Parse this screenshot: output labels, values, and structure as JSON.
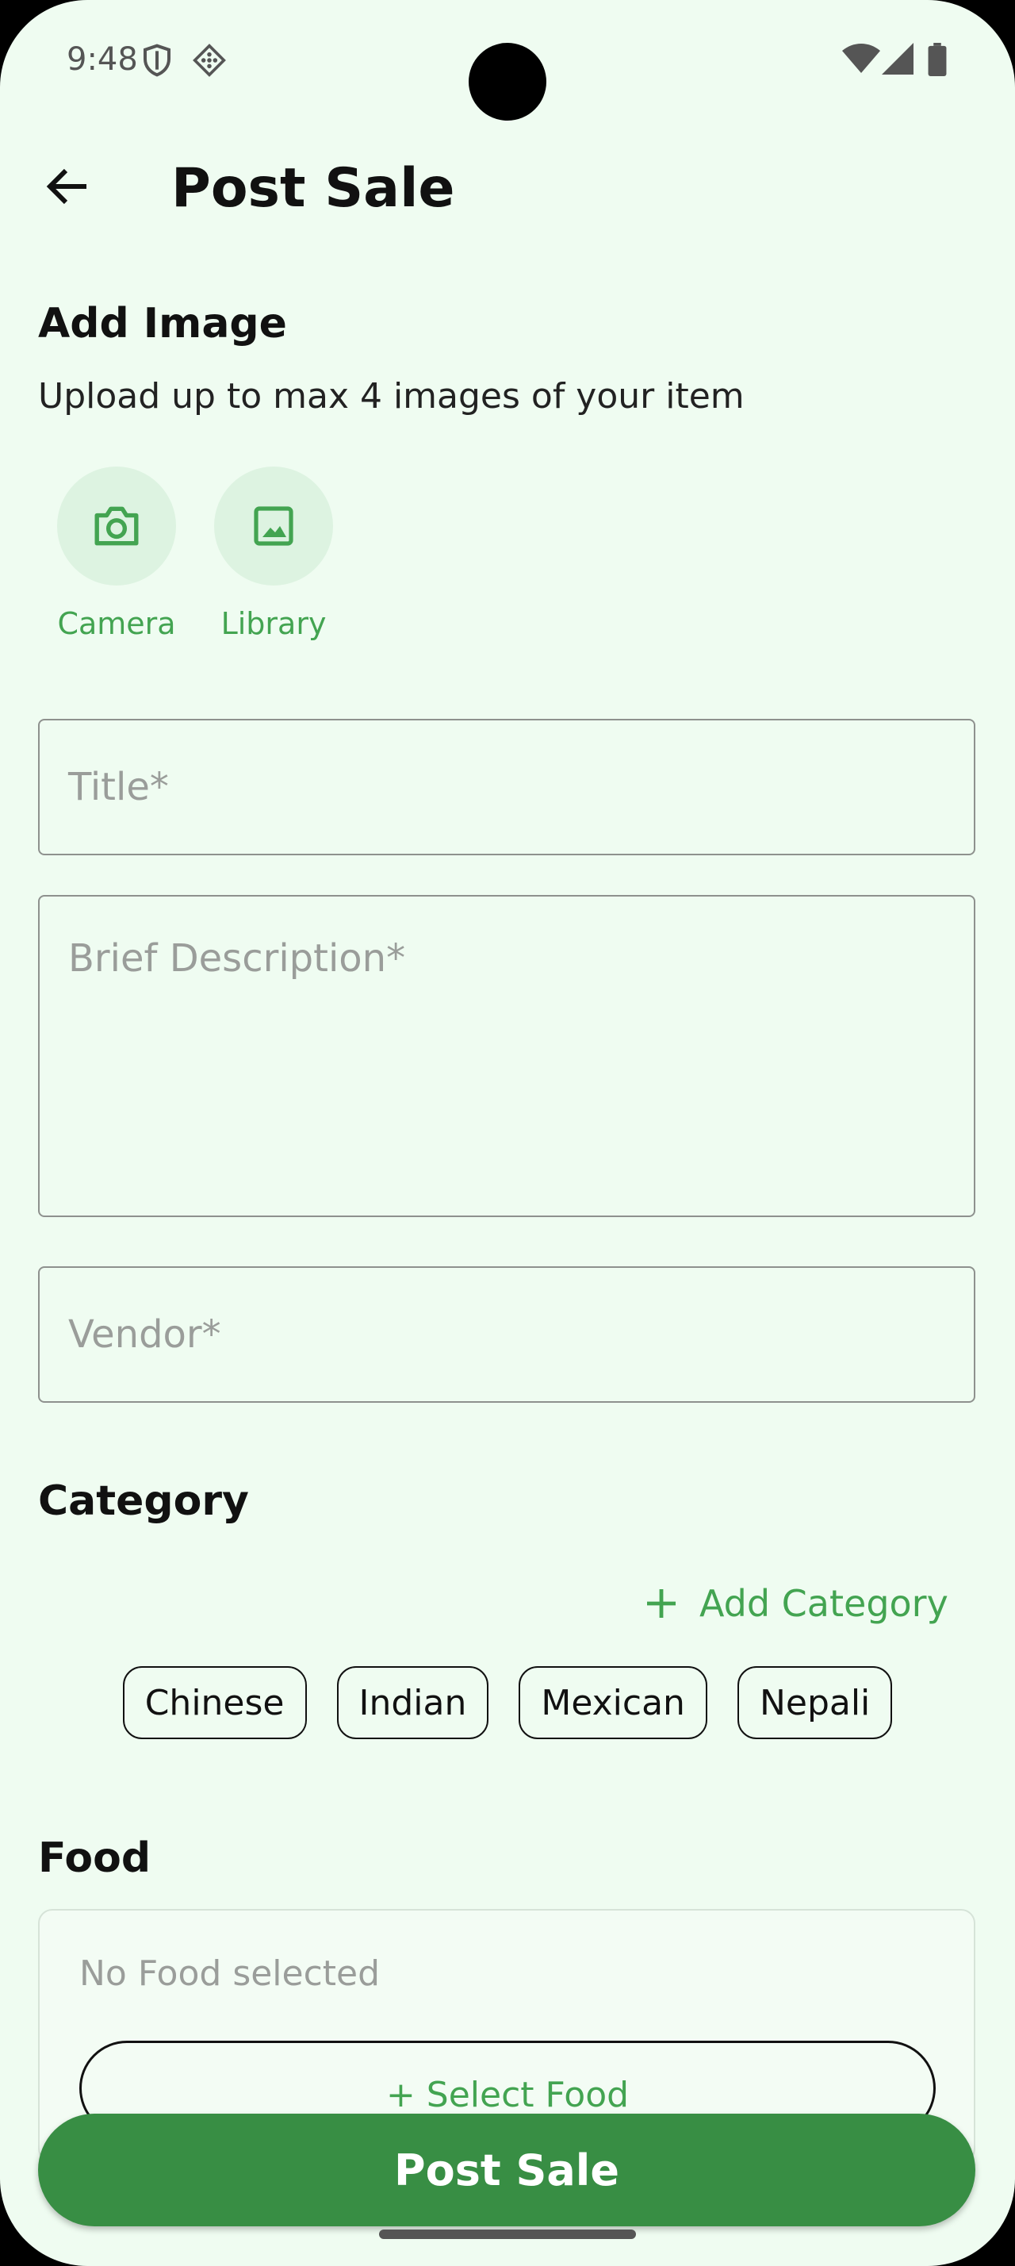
{
  "status_bar": {
    "time": "9:48"
  },
  "header": {
    "title": "Post Sale"
  },
  "add_image": {
    "heading": "Add Image",
    "subtitle": "Upload up to max 4 images of your item",
    "camera_label": "Camera",
    "library_label": "Library"
  },
  "form": {
    "title_placeholder": "Title*",
    "description_placeholder": "Brief Description*",
    "vendor_placeholder": "Vendor*"
  },
  "category": {
    "heading": "Category",
    "add_label": "Add Category",
    "chips": [
      "Chinese",
      "Indian",
      "Mexican",
      "Nepali"
    ]
  },
  "food": {
    "heading": "Food",
    "empty_text": "No Food selected",
    "select_label": "+ Select Food"
  },
  "footer": {
    "post_label": "Post Sale"
  },
  "colors": {
    "accent": "#43A451",
    "primary_button": "#388E44",
    "background": "#EFFCF1"
  }
}
